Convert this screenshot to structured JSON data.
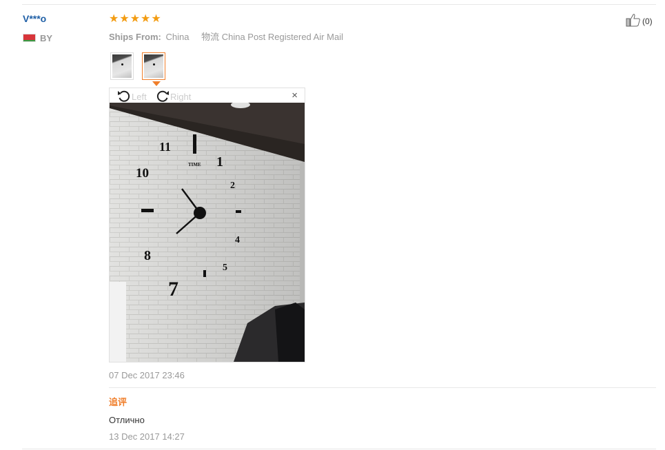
{
  "review": {
    "username": "V***o",
    "country": "BY",
    "rating": [
      "★",
      "★",
      "★",
      "★",
      "★"
    ],
    "ships_from_label": "Ships From:",
    "ships_from_value": "China",
    "logistics_label": "物流",
    "logistics_value": "China Post Registered Air Mail",
    "helpful_count": "(0)",
    "viewer": {
      "rotate_left_label": "Left",
      "rotate_right_label": "Right",
      "close_glyph": "×"
    },
    "date": "07 Dec 2017 23:46",
    "additional": {
      "label": "追评",
      "text": "Отлично",
      "date": "13 Dec 2017 14:27"
    }
  },
  "photo_clock_numbers": [
    "11",
    "1",
    "2",
    "10",
    "4",
    "8",
    "5",
    "7"
  ],
  "colors": {
    "username": "#1f5fa6",
    "star": "#f39c12",
    "accent": "#f07e2a",
    "muted": "#999999",
    "flag_red": "#d8343a",
    "flag_green": "#3a9a42"
  }
}
